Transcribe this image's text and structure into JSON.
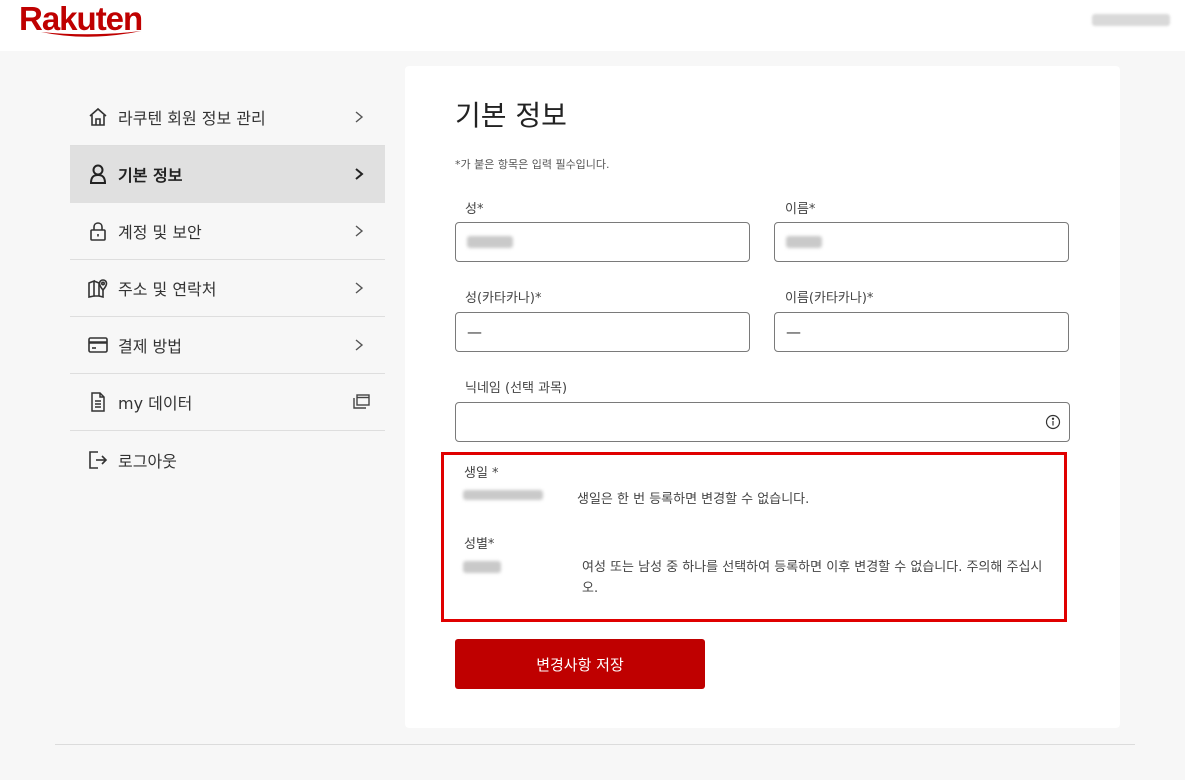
{
  "header": {
    "logo_text": "Rakuten",
    "brand_color": "#bf0000"
  },
  "sidebar": {
    "items": [
      {
        "label": "라쿠텐 회원 정보 관리",
        "icon": "home-icon",
        "trail": "chevron-right-icon"
      },
      {
        "label": "기본 정보",
        "icon": "person-icon",
        "trail": "chevron-right-icon",
        "active": true
      },
      {
        "label": "계정 및 보안",
        "icon": "lock-icon",
        "trail": "chevron-right-icon"
      },
      {
        "label": "주소 및 연락처",
        "icon": "map-pin-icon",
        "trail": "chevron-right-icon"
      },
      {
        "label": "결제 방법",
        "icon": "credit-card-icon",
        "trail": "chevron-right-icon"
      },
      {
        "label": "my 데이터",
        "icon": "document-icon",
        "trail": "external-window-icon"
      },
      {
        "label": "로그아웃",
        "icon": "logout-icon"
      }
    ]
  },
  "main": {
    "title": "기본 정보",
    "required_note": "*가 붙은 항목은 입력 필수입니다.",
    "fields": {
      "last_name": {
        "label": "성*"
      },
      "first_name": {
        "label": "이름*"
      },
      "last_name_kana": {
        "label": "성(카타카나)*",
        "value": "—"
      },
      "first_name_kana": {
        "label": "이름(카타카나)*",
        "value": "—"
      },
      "nickname": {
        "label": "닉네임 (선택 과목)",
        "value": ""
      }
    },
    "birthday": {
      "label": "생일 *",
      "note": "생일은 한 번 등록하면 변경할 수 없습니다."
    },
    "gender": {
      "label": "성별*",
      "note": "여성 또는 남성 중 하나를 선택하여 등록하면 이후 변경할 수 없습니다. 주의해 주십시오."
    },
    "save_button": "변경사항 저장",
    "highlight_color": "#e00000"
  }
}
